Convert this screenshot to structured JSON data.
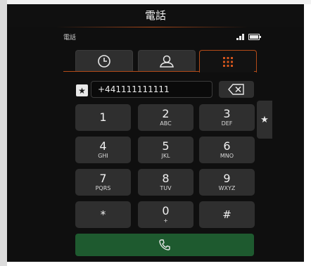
{
  "title": "電話",
  "status": {
    "app_label": "電話"
  },
  "tabs": [
    {
      "icon": "clock-icon"
    },
    {
      "icon": "contacts-icon"
    },
    {
      "icon": "keypad-icon",
      "active": true
    }
  ],
  "dial": {
    "number": "+441111111111"
  },
  "keypad": [
    {
      "digit": "1",
      "letters": ""
    },
    {
      "digit": "2",
      "letters": "ABC"
    },
    {
      "digit": "3",
      "letters": "DEF"
    },
    {
      "digit": "4",
      "letters": "GHI"
    },
    {
      "digit": "5",
      "letters": "JKL"
    },
    {
      "digit": "6",
      "letters": "MNO"
    },
    {
      "digit": "7",
      "letters": "PQRS"
    },
    {
      "digit": "8",
      "letters": "TUV"
    },
    {
      "digit": "9",
      "letters": "WXYZ"
    },
    {
      "digit": "*",
      "letters": ""
    },
    {
      "digit": "0",
      "letters": "+"
    },
    {
      "digit": "#",
      "letters": ""
    }
  ],
  "colors": {
    "accent": "#b34b19",
    "call": "#1e5a2f",
    "key": "#2f2f2f",
    "background": "#0f0f0f"
  }
}
